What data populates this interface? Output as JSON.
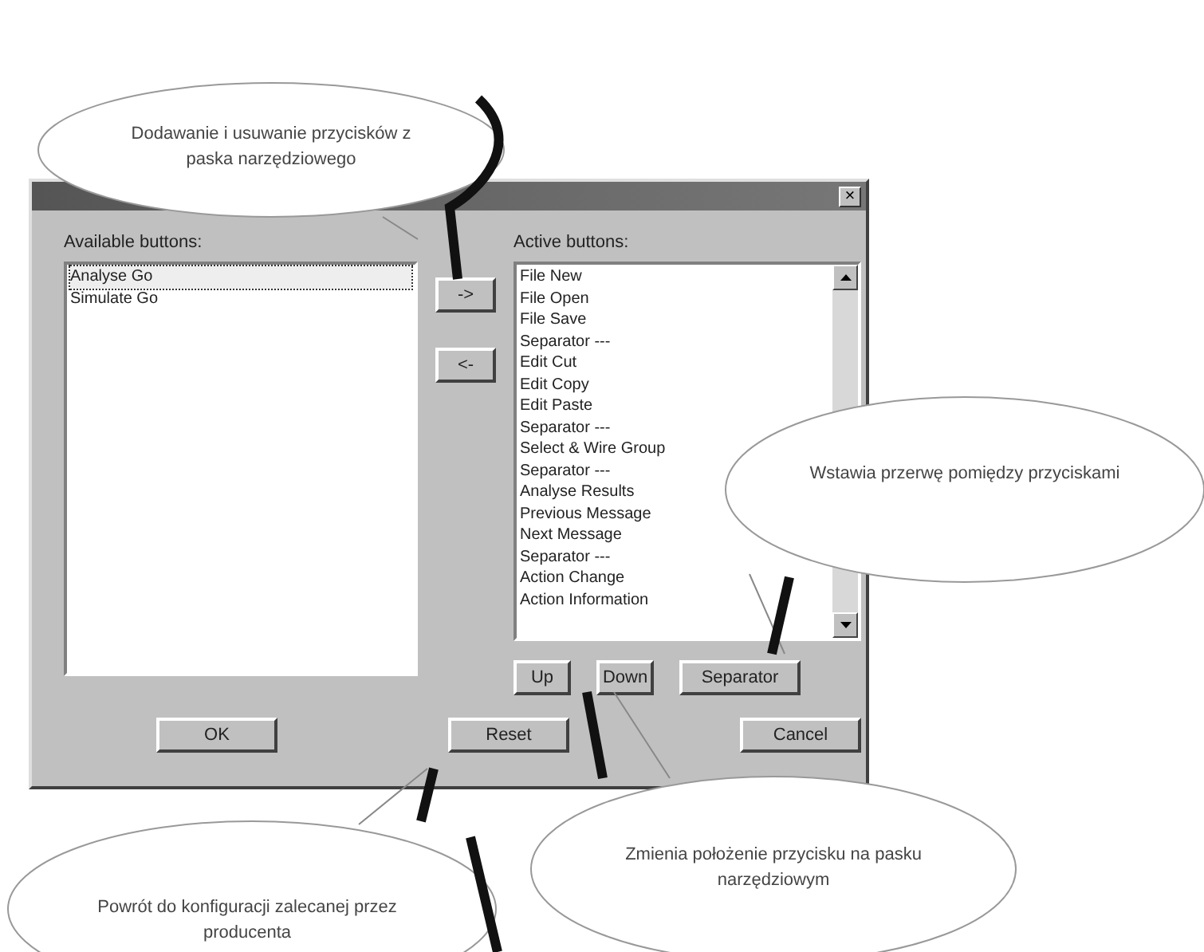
{
  "dialog": {
    "close_button": "×",
    "available": {
      "label": "Available buttons:",
      "items": [
        {
          "text": "Analyse Go",
          "selected": true
        },
        {
          "text": "Simulate Go",
          "selected": false
        }
      ]
    },
    "move_buttons": [
      "->",
      "<-"
    ],
    "active": {
      "label": "Active buttons:",
      "items": [
        {
          "text": "File New"
        },
        {
          "text": "File Open"
        },
        {
          "text": "File Save"
        },
        {
          "text": "Separator ---"
        },
        {
          "text": "Edit Cut"
        },
        {
          "text": "Edit Copy"
        },
        {
          "text": "Edit Paste"
        },
        {
          "text": "Separator ---"
        },
        {
          "text": "Select & Wire Group"
        },
        {
          "text": "Separator ---"
        },
        {
          "text": "Analyse Results"
        },
        {
          "text": "Previous Message"
        },
        {
          "text": "Next Message"
        },
        {
          "text": "Separator ---"
        },
        {
          "text": "Action Change"
        },
        {
          "text": "Action Information"
        }
      ]
    },
    "order_buttons": [
      "Up",
      "Down",
      "Separator"
    ],
    "buttons": [
      "OK",
      "Reset",
      "Cancel"
    ]
  },
  "callouts": [
    {
      "text": "Dodawanie i usuwanie przycisków z paska narzędziowego"
    },
    {
      "text": "Wstawia przerwę pomiędzy przyciskami"
    },
    {
      "text": "Zmienia położenie przycisku na pasku narzędziowym"
    },
    {
      "text": "Powrót do konfiguracji zalecanej przez producenta"
    }
  ]
}
